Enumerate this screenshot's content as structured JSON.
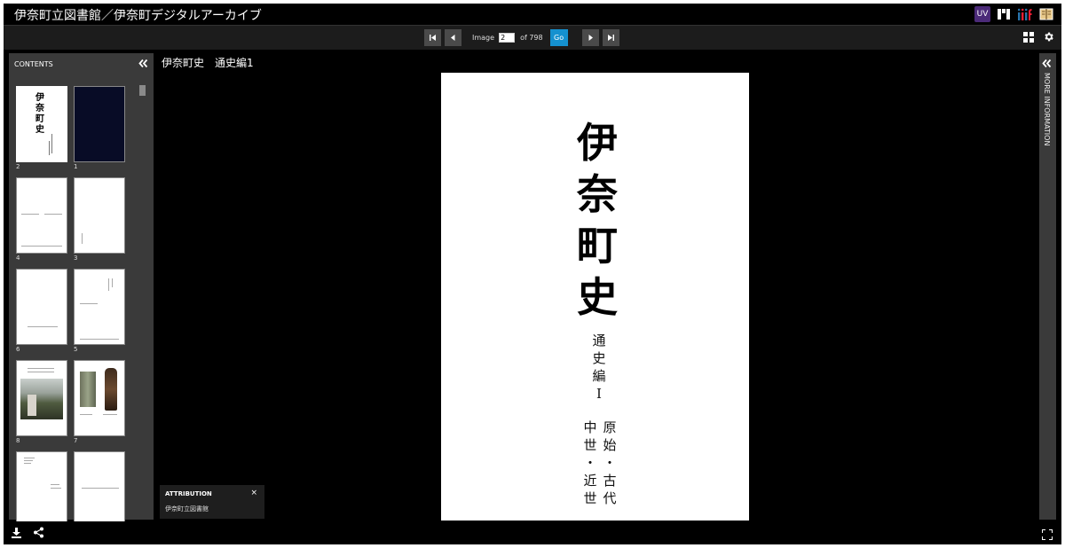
{
  "header": {
    "title": "伊奈町立図書館／伊奈町デジタルアーカイブ"
  },
  "toolbar": {
    "image_label": "Image",
    "current_page": "2",
    "of_label": "of 798",
    "go_label": "Go"
  },
  "contents": {
    "title": "CONTENTS",
    "thumbnails": [
      {
        "label": "2"
      },
      {
        "label": "1"
      },
      {
        "label": "4"
      },
      {
        "label": "3"
      },
      {
        "label": "6"
      },
      {
        "label": "5"
      },
      {
        "label": "8"
      },
      {
        "label": "7"
      },
      {
        "label": ""
      },
      {
        "label": ""
      }
    ]
  },
  "thumb_text": {
    "cover_title": "伊奈町史"
  },
  "main": {
    "doc_title": "伊奈町史　通史編1",
    "page": {
      "title_chars": [
        "伊",
        "奈",
        "町",
        "史"
      ],
      "subtitle_chars": [
        "通",
        "史",
        "編",
        "Ⅰ"
      ],
      "col1_chars": [
        "原",
        "始",
        "・",
        "古",
        "代"
      ],
      "col2_chars": [
        "中",
        "世",
        "・",
        "近",
        "世"
      ]
    }
  },
  "attribution": {
    "title": "ATTRIBUTION",
    "close": "×",
    "text": "伊奈町立図書館"
  },
  "right_panel": {
    "label": "MORE INFORMATION"
  },
  "header_icons": {
    "uv": "UV"
  }
}
